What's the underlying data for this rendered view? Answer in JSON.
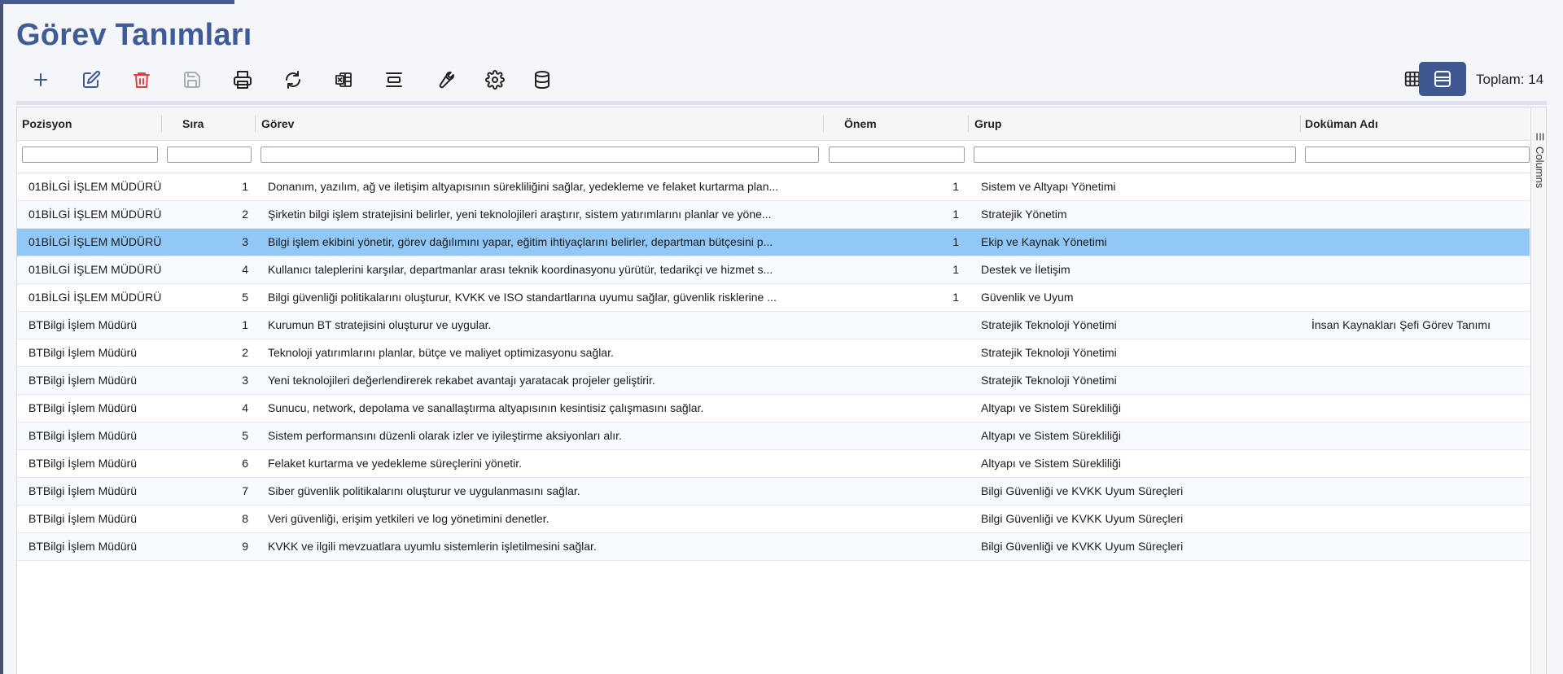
{
  "page": {
    "title": "Görev Tanımları"
  },
  "toolbar": {
    "buttons": [
      {
        "name": "add-button",
        "icon": "plus-icon"
      },
      {
        "name": "edit-button",
        "icon": "edit-icon"
      },
      {
        "name": "delete-button",
        "icon": "trash-icon"
      },
      {
        "name": "save-button",
        "icon": "save-icon"
      },
      {
        "name": "print-button",
        "icon": "printer-icon"
      },
      {
        "name": "refresh-button",
        "icon": "refresh-icon"
      },
      {
        "name": "excel-export-button",
        "icon": "excel-icon"
      },
      {
        "name": "row-height-button",
        "icon": "align-center-icon"
      },
      {
        "name": "tools-button",
        "icon": "wrench-icon"
      },
      {
        "name": "settings-button",
        "icon": "gear-icon"
      },
      {
        "name": "database-button",
        "icon": "database-icon"
      }
    ],
    "view_toggle": [
      "table-view-icon",
      "list-view-icon"
    ],
    "active_view": "list-view-icon",
    "total_label": "Toplam: 14"
  },
  "colors": {
    "title": "#3f5c97",
    "accent": "#3f5891",
    "delete": "#e0413b",
    "selected_row": "#91c8f6",
    "disabled_icon": "#a9adb5"
  },
  "grid": {
    "columns": [
      {
        "key": "pozisyon",
        "label": "Pozisyon"
      },
      {
        "key": "sira",
        "label": "Sıra"
      },
      {
        "key": "gorev",
        "label": "Görev"
      },
      {
        "key": "onem",
        "label": "Önem"
      },
      {
        "key": "grup",
        "label": "Grup"
      },
      {
        "key": "dokuman",
        "label": "Doküman Adı"
      }
    ],
    "side_panel_label": "Columns",
    "selected_row": 2,
    "rows": [
      {
        "pozisyon": "01BİLGİ İŞLEM MÜDÜRÜ",
        "sira": "1",
        "gorev": "Donanım, yazılım, ağ ve iletişim altyapısının sürekliliğini sağlar, yedekleme ve felaket kurtarma plan...",
        "onem": "1",
        "grup": "Sistem ve Altyapı Yönetimi",
        "dokuman": ""
      },
      {
        "pozisyon": "01BİLGİ İŞLEM MÜDÜRÜ",
        "sira": "2",
        "gorev": "Şirketin bilgi işlem stratejisini belirler, yeni teknolojileri araştırır, sistem yatırımlarını planlar ve yöne...",
        "onem": "1",
        "grup": "Stratejik Yönetim",
        "dokuman": ""
      },
      {
        "pozisyon": "01BİLGİ İŞLEM MÜDÜRÜ",
        "sira": "3",
        "gorev": "Bilgi işlem ekibini yönetir, görev dağılımını yapar, eğitim ihtiyaçlarını belirler, departman bütçesini p...",
        "onem": "1",
        "grup": "Ekip ve Kaynak Yönetimi",
        "dokuman": ""
      },
      {
        "pozisyon": "01BİLGİ İŞLEM MÜDÜRÜ",
        "sira": "4",
        "gorev": "Kullanıcı taleplerini karşılar, departmanlar arası teknik koordinasyonu yürütür, tedarikçi ve hizmet s...",
        "onem": "1",
        "grup": "Destek ve İletişim",
        "dokuman": ""
      },
      {
        "pozisyon": "01BİLGİ İŞLEM MÜDÜRÜ",
        "sira": "5",
        "gorev": "Bilgi güvenliği politikalarını oluşturur, KVKK ve ISO standartlarına uyumu sağlar, güvenlik risklerine ...",
        "onem": "1",
        "grup": "Güvenlik ve Uyum",
        "dokuman": ""
      },
      {
        "pozisyon": "BTBilgi İşlem Müdürü",
        "sira": "1",
        "gorev": "Kurumun BT stratejisini oluşturur ve uygular.",
        "onem": "",
        "grup": "Stratejik Teknoloji Yönetimi",
        "dokuman": "İnsan Kaynakları Şefi Görev Tanımı"
      },
      {
        "pozisyon": "BTBilgi İşlem Müdürü",
        "sira": "2",
        "gorev": "Teknoloji yatırımlarını planlar, bütçe ve maliyet optimizasyonu sağlar.",
        "onem": "",
        "grup": "Stratejik Teknoloji Yönetimi",
        "dokuman": ""
      },
      {
        "pozisyon": "BTBilgi İşlem Müdürü",
        "sira": "3",
        "gorev": "Yeni teknolojileri değerlendirerek rekabet avantajı yaratacak projeler geliştirir.",
        "onem": "",
        "grup": "Stratejik Teknoloji Yönetimi",
        "dokuman": ""
      },
      {
        "pozisyon": "BTBilgi İşlem Müdürü",
        "sira": "4",
        "gorev": "Sunucu, network, depolama ve sanallaştırma altyapısının kesintisiz çalışmasını sağlar.",
        "onem": "",
        "grup": "Altyapı ve Sistem Sürekliliği",
        "dokuman": ""
      },
      {
        "pozisyon": "BTBilgi İşlem Müdürü",
        "sira": "5",
        "gorev": "Sistem performansını düzenli olarak izler ve iyileştirme aksiyonları alır.",
        "onem": "",
        "grup": "Altyapı ve Sistem Sürekliliği",
        "dokuman": ""
      },
      {
        "pozisyon": "BTBilgi İşlem Müdürü",
        "sira": "6",
        "gorev": "Felaket kurtarma ve yedekleme süreçlerini yönetir.",
        "onem": "",
        "grup": "Altyapı ve Sistem Sürekliliği",
        "dokuman": ""
      },
      {
        "pozisyon": "BTBilgi İşlem Müdürü",
        "sira": "7",
        "gorev": "Siber güvenlik politikalarını oluşturur ve uygulanmasını sağlar.",
        "onem": "",
        "grup": "Bilgi Güvenliği ve KVKK Uyum Süreçleri",
        "dokuman": ""
      },
      {
        "pozisyon": "BTBilgi İşlem Müdürü",
        "sira": "8",
        "gorev": "Veri güvenliği, erişim yetkileri ve log yönetimini denetler.",
        "onem": "",
        "grup": "Bilgi Güvenliği ve KVKK Uyum Süreçleri",
        "dokuman": ""
      },
      {
        "pozisyon": "BTBilgi İşlem Müdürü",
        "sira": "9",
        "gorev": "KVKK ve ilgili mevzuatlara uyumlu sistemlerin işletilmesini sağlar.",
        "onem": "",
        "grup": "Bilgi Güvenliği ve KVKK Uyum Süreçleri",
        "dokuman": ""
      }
    ]
  }
}
